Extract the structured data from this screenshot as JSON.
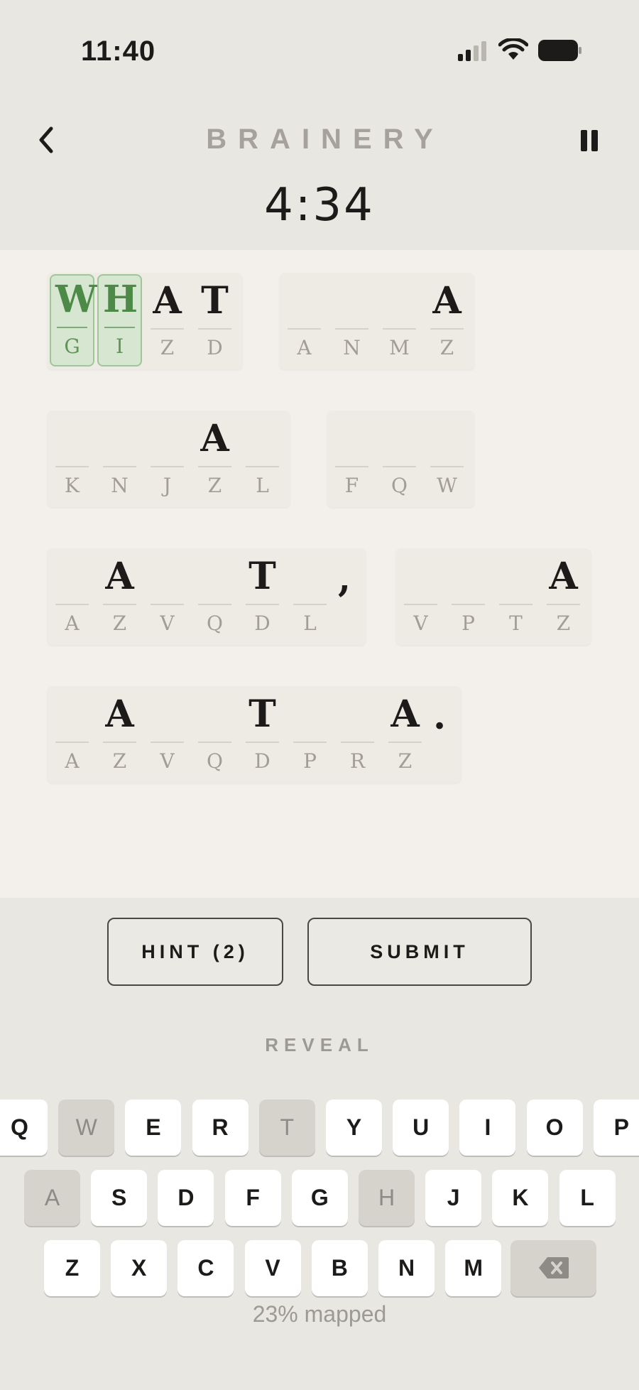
{
  "status": {
    "time": "11:40"
  },
  "header": {
    "title": "BRAINERY",
    "timer": "4:34"
  },
  "colors": {
    "solved_green": "#4d8a47",
    "background": "#e9e7e2",
    "puzzle_bg": "#f3f0eb"
  },
  "puzzle": {
    "words": [
      {
        "cells": [
          {
            "p": "W",
            "c": "G",
            "solved": true
          },
          {
            "p": "H",
            "c": "I",
            "solved": true
          },
          {
            "p": "A",
            "c": "Z"
          },
          {
            "p": "T",
            "c": "D"
          }
        ],
        "punct": ""
      },
      {
        "cells": [
          {
            "p": "",
            "c": "A"
          },
          {
            "p": "",
            "c": "N"
          },
          {
            "p": "",
            "c": "M"
          },
          {
            "p": "A",
            "c": "Z"
          }
        ],
        "punct": ""
      },
      {
        "cells": [
          {
            "p": "",
            "c": "K"
          },
          {
            "p": "",
            "c": "N"
          },
          {
            "p": "",
            "c": "J"
          },
          {
            "p": "A",
            "c": "Z"
          },
          {
            "p": "",
            "c": "L"
          }
        ],
        "punct": ""
      },
      {
        "cells": [
          {
            "p": "",
            "c": "F"
          },
          {
            "p": "",
            "c": "Q"
          },
          {
            "p": "",
            "c": "W"
          }
        ],
        "punct": ""
      },
      {
        "cells": [
          {
            "p": "",
            "c": "A"
          },
          {
            "p": "A",
            "c": "Z"
          },
          {
            "p": "",
            "c": "V"
          },
          {
            "p": "",
            "c": "Q"
          },
          {
            "p": "T",
            "c": "D"
          },
          {
            "p": "",
            "c": "L"
          }
        ],
        "punct": ","
      },
      {
        "cells": [
          {
            "p": "",
            "c": "V"
          },
          {
            "p": "",
            "c": "P"
          },
          {
            "p": "",
            "c": "T"
          },
          {
            "p": "A",
            "c": "Z"
          }
        ],
        "punct": ""
      },
      {
        "cells": [
          {
            "p": "",
            "c": "A"
          },
          {
            "p": "A",
            "c": "Z"
          },
          {
            "p": "",
            "c": "V"
          },
          {
            "p": "",
            "c": "Q"
          },
          {
            "p": "T",
            "c": "D"
          },
          {
            "p": "",
            "c": "P"
          },
          {
            "p": "",
            "c": "R"
          },
          {
            "p": "A",
            "c": "Z"
          }
        ],
        "punct": "."
      }
    ]
  },
  "actions": {
    "hint_label": "HINT (2)",
    "submit_label": "SUBMIT",
    "reveal_label": "REVEAL"
  },
  "keyboard": {
    "rows": [
      [
        "Q",
        "W",
        "E",
        "R",
        "T",
        "Y",
        "U",
        "I",
        "O",
        "P"
      ],
      [
        "A",
        "S",
        "D",
        "F",
        "G",
        "H",
        "J",
        "K",
        "L"
      ],
      [
        "Z",
        "X",
        "C",
        "V",
        "B",
        "N",
        "M"
      ]
    ],
    "used_keys": [
      "W",
      "T",
      "A",
      "H"
    ],
    "delete_icon": "backspace-icon"
  },
  "progress": {
    "label": "23% mapped",
    "percent": 23
  }
}
